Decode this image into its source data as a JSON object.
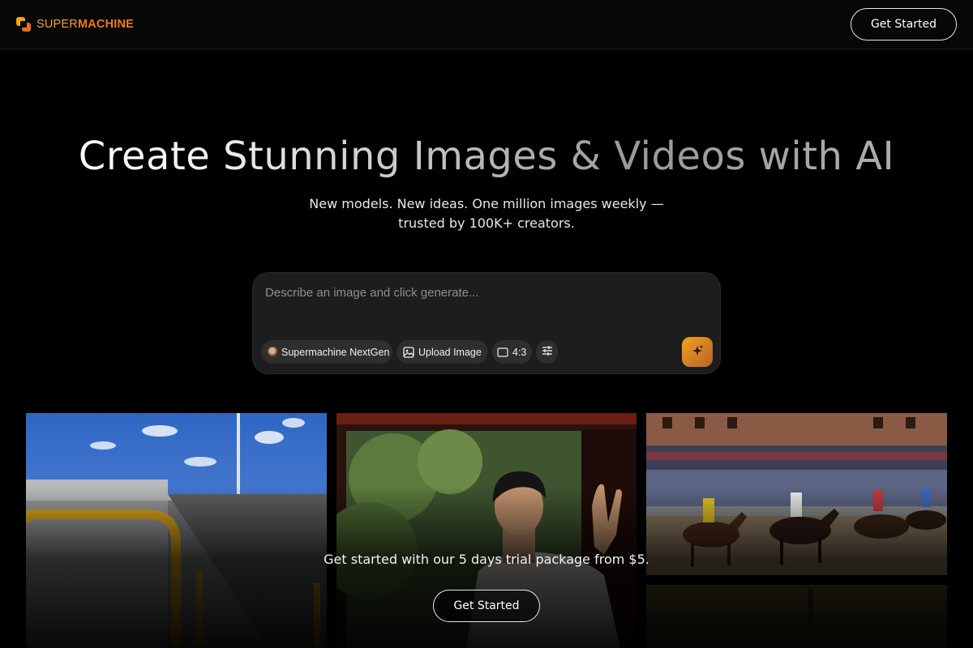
{
  "header": {
    "logo_word1": "SUPER",
    "logo_word2": "MACHINE",
    "cta_label": "Get Started"
  },
  "hero": {
    "title": "Create Stunning Images & Videos with AI",
    "subtitle_line1": "New models. New ideas. One million images weekly —",
    "subtitle_line2": "trusted by 100K+ creators."
  },
  "prompt": {
    "placeholder": "Describe an image and click generate...",
    "model_label": "Supermachine NextGen",
    "upload_label": "Upload Image",
    "ratio_label": "4:3",
    "icons": {
      "upload": "image-icon",
      "ratio": "aspect-ratio-icon",
      "settings": "sliders-icon",
      "generate": "sparkles-icon"
    }
  },
  "gallery": {
    "items": [
      {
        "subject": "building-sky-yellow-railing"
      },
      {
        "subject": "man-at-window"
      },
      {
        "subject": "horse-race-crowd"
      },
      {
        "subject": "dark-landscape"
      }
    ]
  },
  "promo": {
    "text": "Get started with our 5 days trial package from $5.",
    "cta_label": "Get Started"
  },
  "colors": {
    "background": "#000000",
    "brand_yellow": "#f3a51a",
    "brand_orange": "#f07a16",
    "prompt_bg": "#1d1d1d",
    "chip_bg": "#2e2e2e"
  }
}
